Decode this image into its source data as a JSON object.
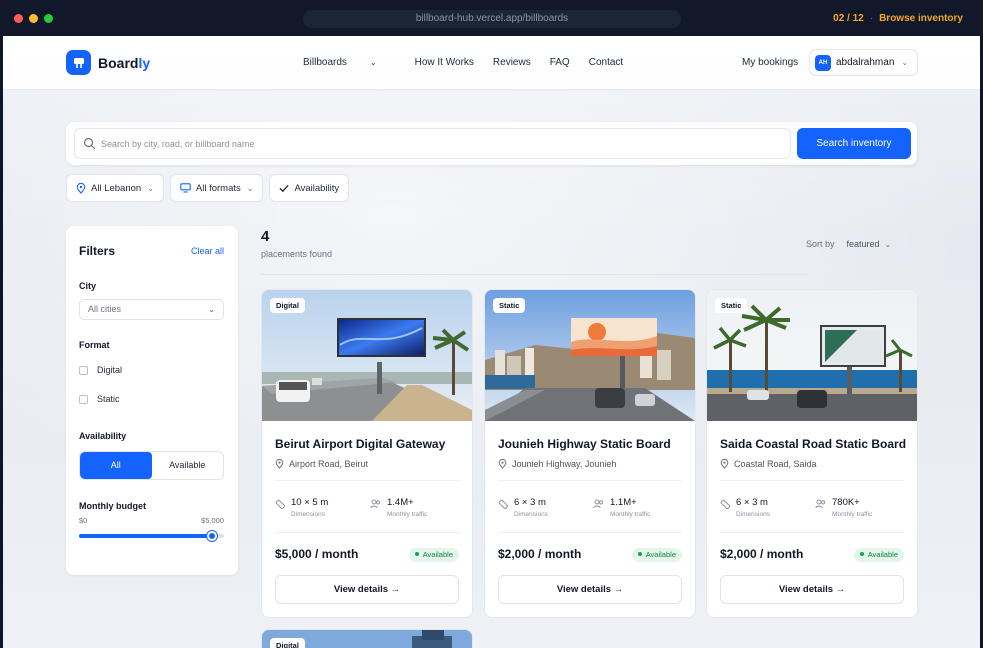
{
  "browser": {
    "url": "billboard-hub.vercel.app/billboards",
    "progress": "02 / 12",
    "action": "Browse inventory",
    "dot_colors": [
      "#ff5f57",
      "#febc2e",
      "#28c840"
    ]
  },
  "nav": {
    "logo_prefix": "Board",
    "logo_accent": "ly",
    "links": [
      {
        "label": "Billboards",
        "has_dropdown": true
      },
      {
        "label": "How It Works"
      },
      {
        "label": "Reviews"
      },
      {
        "label": "FAQ"
      },
      {
        "label": "Contact"
      }
    ],
    "my_bookings": "My bookings",
    "user_initials": "AH",
    "user_name": "abdalrahman"
  },
  "search": {
    "placeholder": "Search by city, road, or billboard name",
    "value": "",
    "button": "Search inventory"
  },
  "chips": [
    {
      "label": "All Lebanon",
      "icon": "location-pin-icon"
    },
    {
      "label": "All formats",
      "icon": "monitor-icon"
    },
    {
      "label": "Availability",
      "icon": "check-icon"
    }
  ],
  "filters": {
    "title": "Filters",
    "clear": "Clear all",
    "city_label": "City",
    "city_value": "All cities",
    "format_label": "Format",
    "formats": [
      "Digital",
      "Static"
    ],
    "availability_label": "Availability",
    "availability_options": [
      "All",
      "Available"
    ],
    "availability_selected": "All",
    "budget_label": "Monthly budget",
    "budget_min": "$0",
    "budget_max": "$5,000",
    "budget_fraction": 0.92
  },
  "results": {
    "count": "4",
    "count_label": "placements found",
    "sort_label": "Sort by",
    "sort_value": "featured"
  },
  "cards": [
    {
      "badge": "Digital",
      "title": "Beirut Airport Digital Gateway",
      "location": "Airport Road, Beirut",
      "dimensions": "10 × 5 m",
      "dimensions_label": "Dimensions",
      "traffic": "1.4M+",
      "traffic_label": "Monthly traffic",
      "price": "$5,000 / month",
      "status": "Available",
      "cta": "View details"
    },
    {
      "badge": "Static",
      "title": "Jounieh Highway Static Board",
      "location": "Jounieh Highway, Jounieh",
      "dimensions": "6 × 3 m",
      "dimensions_label": "Dimensions",
      "traffic": "1.1M+",
      "traffic_label": "Monthly traffic",
      "price": "$2,000 / month",
      "status": "Available",
      "cta": "View details"
    },
    {
      "badge": "Static",
      "title": "Saida Coastal Road Static Board",
      "location": "Coastal Road, Saida",
      "dimensions": "6 × 3 m",
      "dimensions_label": "Dimensions",
      "traffic": "780K+",
      "traffic_label": "Monthly traffic",
      "price": "$2,000 / month",
      "status": "Available",
      "cta": "View details"
    },
    {
      "badge": "Digital"
    }
  ],
  "colors": {
    "brand": "#1463ff",
    "available_bg": "#e4f6ec",
    "available_text": "#15803d",
    "accent_orange": "#f5a623"
  }
}
